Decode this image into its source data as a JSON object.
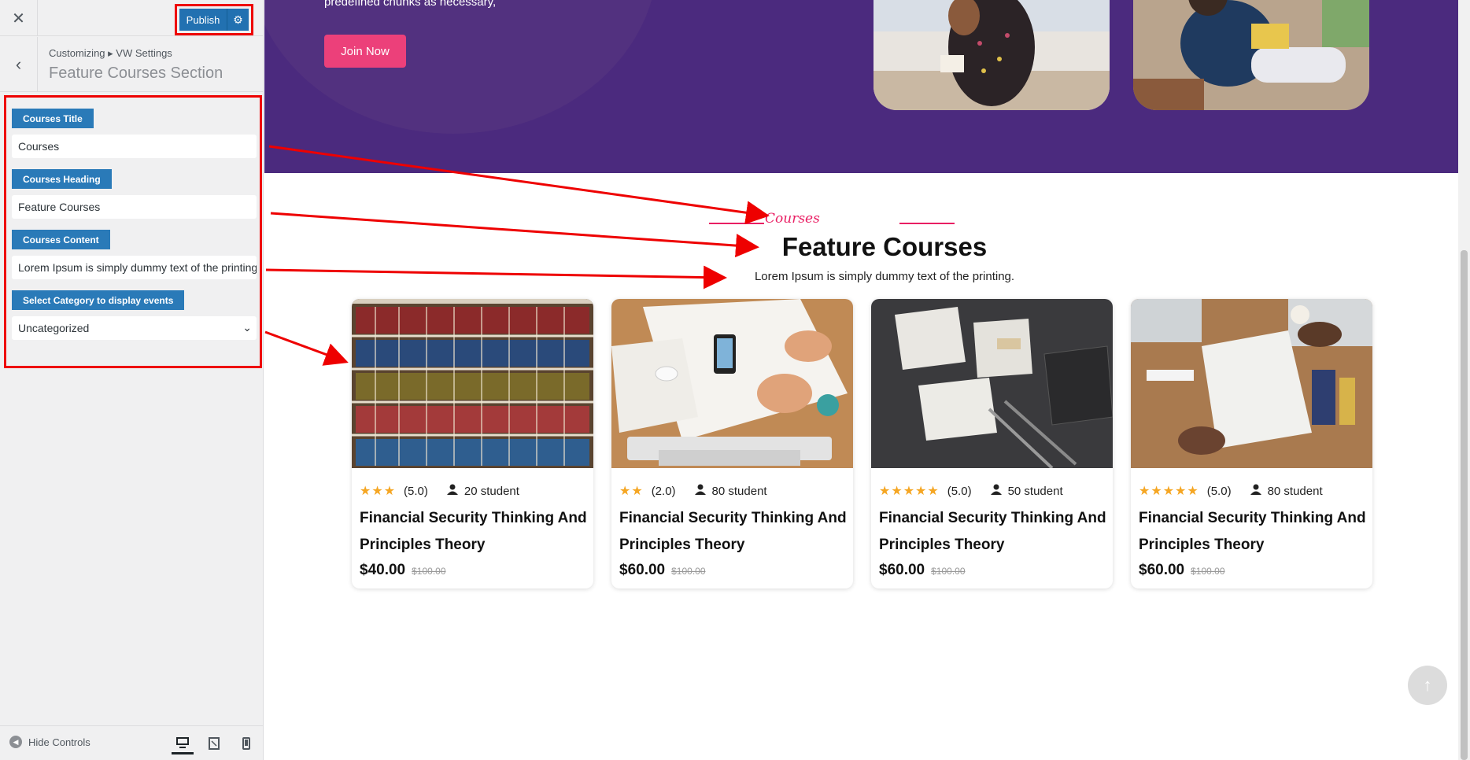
{
  "sidebar": {
    "close_icon": "close-icon",
    "publish_label": "Publish",
    "gear_icon": "gear-icon",
    "breadcrumb": "Customizing ▸ VW Settings",
    "section_title": "Feature Courses Section",
    "controls": [
      {
        "label": "Courses Title",
        "value": "Courses"
      },
      {
        "label": "Courses Heading",
        "value": "Feature Courses"
      },
      {
        "label": "Courses Content",
        "value": "Lorem Ipsum is simply dummy text of the printing."
      },
      {
        "label": "Select Category to display events",
        "value": "Uncategorized"
      }
    ],
    "hide_controls_label": "Hide Controls",
    "devices": [
      "desktop-icon",
      "tablet-icon",
      "mobile-icon"
    ]
  },
  "preview": {
    "hero": {
      "text": "predefined chunks as necessary,",
      "button_label": "Join Now"
    },
    "courses_title": "Courses",
    "courses_heading": "Feature Courses",
    "courses_content": "Lorem Ipsum is simply dummy text of the printing.",
    "cards": [
      {
        "stars": "★★★",
        "rating": "(5.0)",
        "students": "20 student",
        "title": "Financial Security Thinking And Principles Theory",
        "price": "$40.00",
        "old_price": "$100.00",
        "image": "bookshelf"
      },
      {
        "stars": "★★",
        "rating": "(2.0)",
        "students": "80 student",
        "title": "Financial Security Thinking And Principles Theory",
        "price": "$60.00",
        "old_price": "$100.00",
        "image": "desk-sketching"
      },
      {
        "stars": "★★★★★",
        "rating": "(5.0)",
        "students": "50 student",
        "title": "Financial Security Thinking And Principles Theory",
        "price": "$60.00",
        "old_price": "$100.00",
        "image": "wireframes-on-table"
      },
      {
        "stars": "★★★★★",
        "rating": "(5.0)",
        "students": "80 student",
        "title": "Financial Security Thinking And Principles Theory",
        "price": "$60.00",
        "old_price": "$100.00",
        "image": "team-meeting"
      }
    ],
    "scroll_top_icon": "arrow-up-icon"
  },
  "colors": {
    "accent": "#2271b1",
    "hero_bg": "#4b2a7e",
    "pink": "#ec407a",
    "star": "#f5a623",
    "annotation": "#e00000"
  }
}
